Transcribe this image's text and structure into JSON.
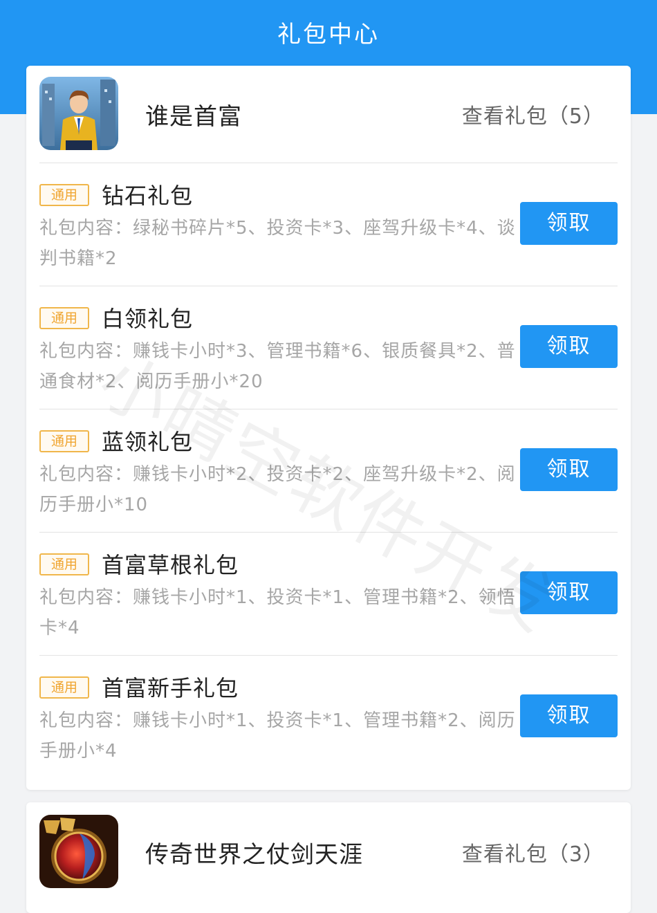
{
  "header": {
    "title": "礼包中心"
  },
  "games": [
    {
      "name": "谁是首富",
      "view_label": "查看礼包（5）",
      "gifts": [
        {
          "tag": "通用",
          "name": "钻石礼包",
          "content": "礼包内容：绿秘书碎片*5、投资卡*3、座驾升级卡*4、谈判书籍*2",
          "button": "领取"
        },
        {
          "tag": "通用",
          "name": "白领礼包",
          "content": "礼包内容：赚钱卡小时*3、管理书籍*6、银质餐具*2、普通食材*2、阅历手册小*20",
          "button": "领取"
        },
        {
          "tag": "通用",
          "name": "蓝领礼包",
          "content": "礼包内容：赚钱卡小时*2、投资卡*2、座驾升级卡*2、阅历手册小*10",
          "button": "领取"
        },
        {
          "tag": "通用",
          "name": "首富草根礼包",
          "content": "礼包内容：赚钱卡小时*1、投资卡*1、管理书籍*2、领悟卡*4",
          "button": "领取"
        },
        {
          "tag": "通用",
          "name": "首富新手礼包",
          "content": "礼包内容：赚钱卡小时*1、投资卡*1、管理书籍*2、阅历手册小*4",
          "button": "领取"
        }
      ]
    },
    {
      "name": "传奇世界之仗剑天涯",
      "view_label": "查看礼包（3）"
    }
  ],
  "watermark": "小晴空软件开发",
  "colors": {
    "primary": "#2196f3",
    "tag": "#f0a530",
    "content_text": "#a6a6a6"
  },
  "icons": {
    "game1": "businessman-game-icon",
    "game2": "legend-emblem-game-icon"
  }
}
